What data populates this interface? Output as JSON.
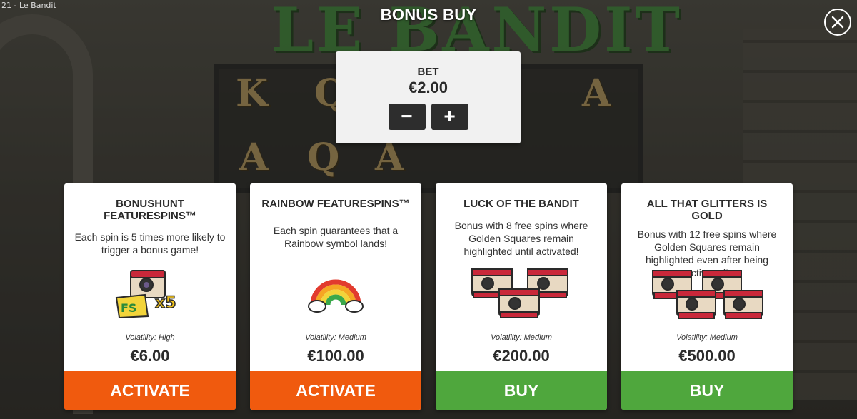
{
  "window": {
    "title": "21 - Le Bandit"
  },
  "background": {
    "logo_text": "LE BANDIT"
  },
  "header": {
    "title": "BONUS BUY",
    "close_icon": "close-icon"
  },
  "bet": {
    "label": "BET",
    "value": "€2.00",
    "minus_label": "−",
    "plus_label": "+"
  },
  "cards": [
    {
      "name": "BONUSHUNT FEATURESPINS™",
      "description": "Each spin is 5 times more likely to trigger a bonus game!",
      "icon": "fs-x5-camera-icon",
      "volatility": "Volatility: High",
      "price": "€6.00",
      "action": "ACTIVATE",
      "action_color": "#f05a0e"
    },
    {
      "name": "RAINBOW FEATURESPINS™",
      "description": "Each spin guarantees that a Rainbow symbol lands!",
      "icon": "rainbow-icon",
      "volatility": "Volatility: Medium",
      "price": "€100.00",
      "action": "ACTIVATE",
      "action_color": "#f05a0e"
    },
    {
      "name": "LUCK OF THE BANDIT",
      "description": "Bonus with 8 free spins where Golden Squares remain highlighted until activated!",
      "icon": "three-cameras-icon",
      "volatility": "Volatility: Medium",
      "price": "€200.00",
      "action": "BUY",
      "action_color": "#4fa73d"
    },
    {
      "name": "ALL THAT GLITTERS IS GOLD",
      "description": "Bonus with 12 free spins where Golden Squares remain highlighted even after being activated!",
      "icon": "four-cameras-icon",
      "volatility": "Volatility: Medium",
      "price": "€500.00",
      "action": "BUY",
      "action_color": "#4fa73d"
    }
  ],
  "colors": {
    "activate": "#f05a0e",
    "buy": "#4fa73d",
    "panel": "#f1f1f1",
    "dark_button": "#2d2d2d"
  }
}
